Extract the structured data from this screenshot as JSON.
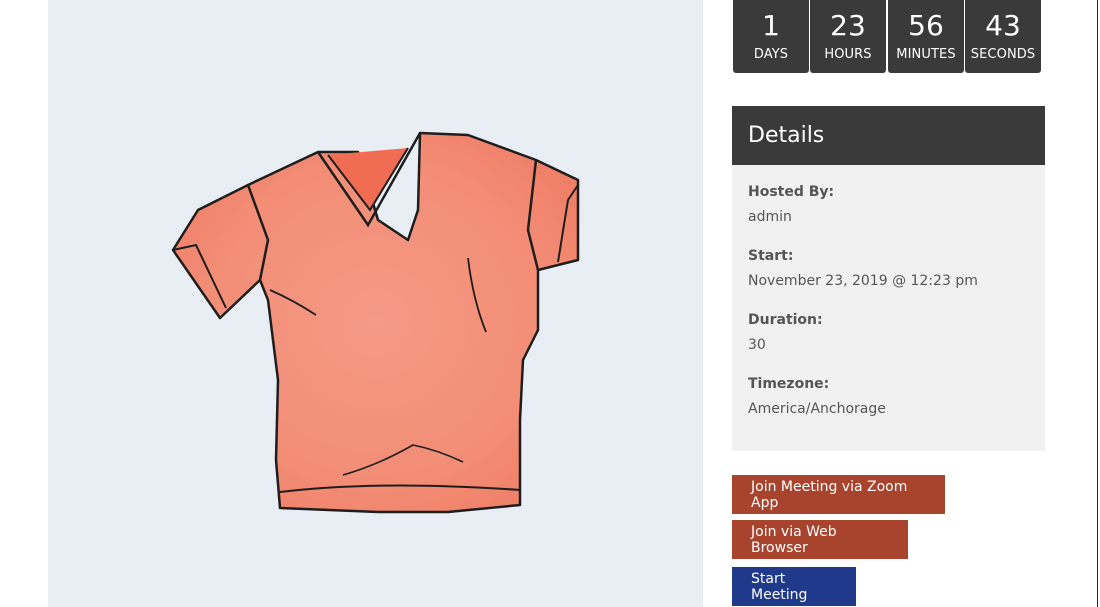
{
  "countdown": {
    "days": {
      "value": "1",
      "unit": "DAYS"
    },
    "hours": {
      "value": "23",
      "unit": "HOURS"
    },
    "minutes": {
      "value": "56",
      "unit": "MINUTES"
    },
    "seconds": {
      "value": "43",
      "unit": "SECONDS"
    }
  },
  "details": {
    "title": "Details",
    "hosted_by": {
      "label": "Hosted By:",
      "value": "admin"
    },
    "start": {
      "label": "Start:",
      "value": "November 23, 2019 @ 12:23 pm"
    },
    "duration": {
      "label": "Duration:",
      "value": "30"
    },
    "timezone": {
      "label": "Timezone:",
      "value": "America/Anchorage"
    }
  },
  "buttons": {
    "join_zoom_app": "Join Meeting via Zoom App",
    "join_web_browser": "Join via Web Browser",
    "start_meeting": "Start Meeting"
  },
  "colors": {
    "countdown_bg": "#3a3a3a",
    "join_button": "#a8432e",
    "start_button": "#1f3a8a",
    "image_bg": "#e8eef3",
    "tshirt": "#f2927c"
  },
  "product_image": {
    "icon": "tshirt-illustration"
  }
}
